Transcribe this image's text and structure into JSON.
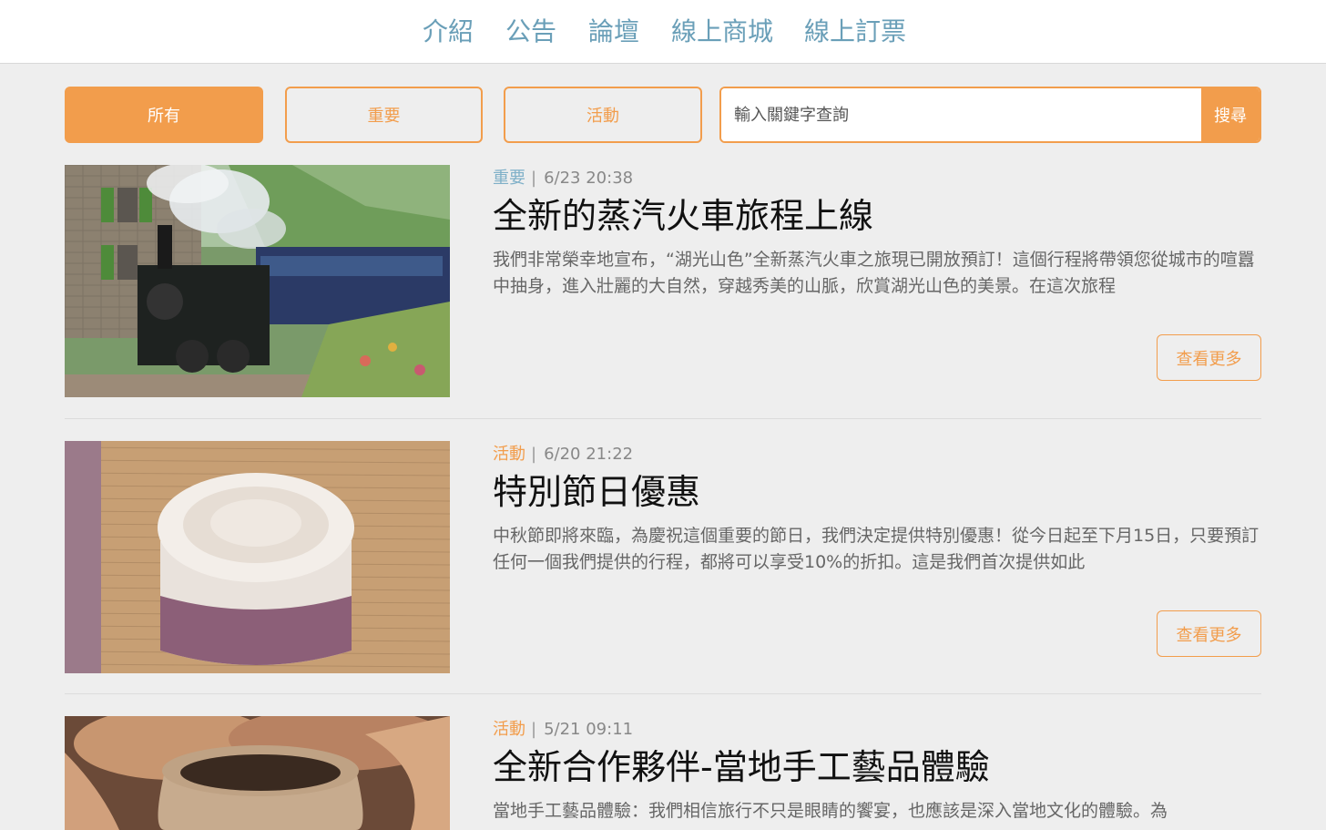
{
  "nav": {
    "items": [
      "介紹",
      "公告",
      "論壇",
      "線上商城",
      "線上訂票"
    ]
  },
  "filters": {
    "all": "所有",
    "important": "重要",
    "event": "活動"
  },
  "search": {
    "placeholder": "輸入關鍵字查詢",
    "button": "搜尋"
  },
  "articles": [
    {
      "tag": "重要",
      "date": "6/23 20:38",
      "title": "全新的蒸汽火車旅程上線",
      "excerpt": "我們非常榮幸地宣布，“湖光山色”全新蒸汽火車之旅現已開放預訂！這個行程將帶領您從城市的喧囂中抽身，進入壯麗的大自然，穿越秀美的山脈，欣賞湖光山色的美景。在這次旅程",
      "more": "查看更多",
      "image": "steam-train-photo"
    },
    {
      "tag": "活動",
      "date": "6/20 21:22",
      "title": "特別節日優惠",
      "excerpt": "中秋節即將來臨，為慶祝這個重要的節日，我們決定提供特別優惠！從今日起至下月15日，只要預訂任何一個我們提供的行程，都將可以享受10%的折扣。這是我們首次提供如此",
      "more": "查看更多",
      "image": "mooncake-photo"
    },
    {
      "tag": "活動",
      "date": "5/21 09:11",
      "title": "全新合作夥伴-當地手工藝品體驗",
      "excerpt": "當地手工藝品體驗：我們相信旅行不只是眼睛的饗宴，也應該是深入當地文化的體驗。為",
      "image": "pottery-photo"
    }
  ],
  "colors": {
    "accent": "#f29d4c",
    "nav_link": "#6a9fb8",
    "tag_important": "#7fb0c8",
    "background": "#eeeeee"
  }
}
